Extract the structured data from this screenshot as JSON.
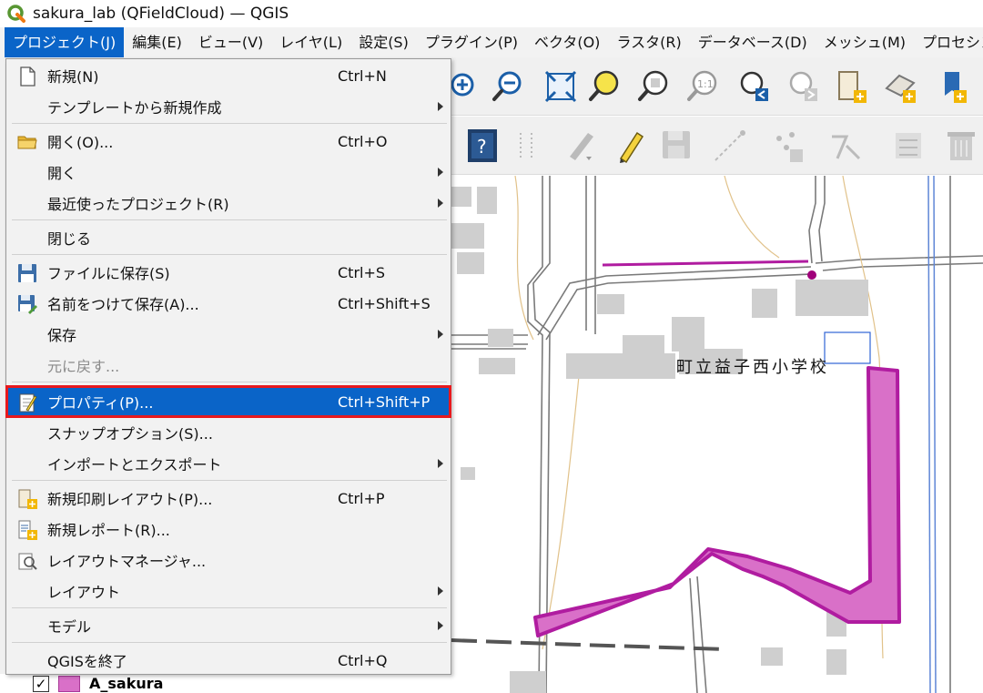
{
  "window": {
    "title": "sakura_lab (QFieldCloud) — QGIS"
  },
  "menubar": [
    "プロジェクト(J)",
    "編集(E)",
    "ビュー(V)",
    "レイヤ(L)",
    "設定(S)",
    "プラグイン(P)",
    "ベクタ(O)",
    "ラスタ(R)",
    "データベース(D)",
    "メッシュ(M)",
    "プロセシング"
  ],
  "project_menu": {
    "new": {
      "label": "新規(N)",
      "shortcut": "Ctrl+N"
    },
    "new_from_template": {
      "label": "テンプレートから新規作成"
    },
    "open": {
      "label": "開く(O)...",
      "shortcut": "Ctrl+O"
    },
    "open_from": {
      "label": "開く"
    },
    "recent": {
      "label": "最近使ったプロジェクト(R)"
    },
    "close": {
      "label": "閉じる"
    },
    "save": {
      "label": "ファイルに保存(S)",
      "shortcut": "Ctrl+S"
    },
    "save_as": {
      "label": "名前をつけて保存(A)...",
      "shortcut": "Ctrl+Shift+S"
    },
    "save_to": {
      "label": "保存"
    },
    "revert": {
      "label": "元に戻す..."
    },
    "properties": {
      "label": "プロパティ(P)...",
      "shortcut": "Ctrl+Shift+P"
    },
    "snapping": {
      "label": "スナップオプション(S)..."
    },
    "import_export": {
      "label": "インポートとエクスポート"
    },
    "new_print_layout": {
      "label": "新規印刷レイアウト(P)...",
      "shortcut": "Ctrl+P"
    },
    "new_report": {
      "label": "新規レポート(R)..."
    },
    "layout_manager": {
      "label": "レイアウトマネージャ..."
    },
    "layouts": {
      "label": "レイアウト"
    },
    "models": {
      "label": "モデル"
    },
    "exit": {
      "label": "QGISを終了",
      "shortcut": "Ctrl+Q"
    }
  },
  "map": {
    "label": "町立益子西小学校"
  },
  "layers_panel": {
    "layer_name": "A_sakura",
    "checked": "✓"
  },
  "colors": {
    "accent": "#0a64c8",
    "highlight_border": "#e8191d",
    "polygon_fill": "#d970c8",
    "polygon_stroke": "#b01ca0"
  }
}
